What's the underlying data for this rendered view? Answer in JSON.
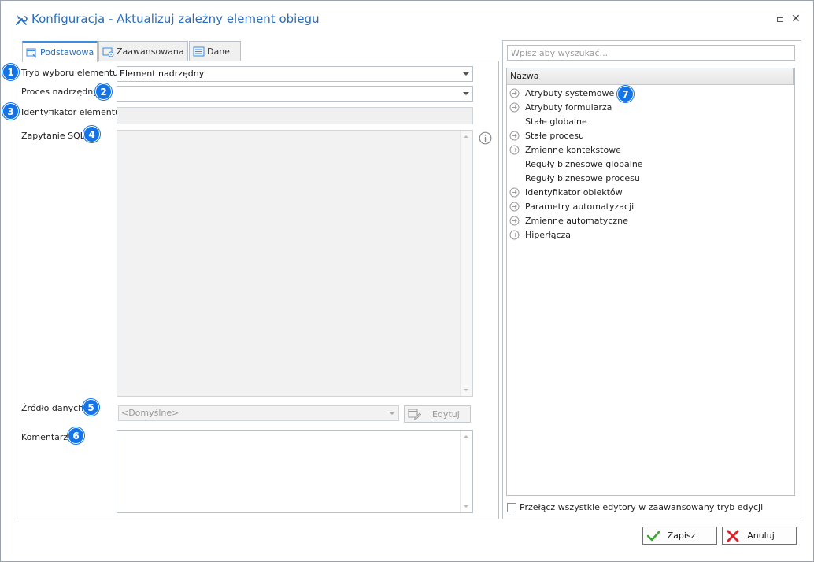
{
  "window": {
    "title": "Konfiguracja - Aktualizuj zależny element obiegu",
    "maximize_icon": "maximize-icon",
    "close_icon": "close-icon",
    "close_glyph": "✕"
  },
  "tabs": [
    {
      "label": "Podstawowa",
      "icon": "basic-settings-icon",
      "active": true
    },
    {
      "label": "Zaawansowana",
      "icon": "advanced-settings-icon",
      "active": false
    },
    {
      "label": "Dane",
      "icon": "data-list-icon",
      "active": false
    }
  ],
  "form": {
    "selection_mode": {
      "label": "Tryb wyboru elementu:",
      "value": "Element nadrzędny",
      "badge": "1"
    },
    "parent_process": {
      "label": "Proces nadrzędny:",
      "value": "",
      "badge": "2"
    },
    "element_id": {
      "label": "Identyfikator elementu:",
      "value": "",
      "badge": "3"
    },
    "sql_query": {
      "label": "Zapytanie SQL:",
      "value": "",
      "badge": "4"
    },
    "data_source": {
      "label": "Źródło danych:",
      "value": "<Domyślne>",
      "badge": "5",
      "edit_label": "Edytuj"
    },
    "comment": {
      "label": "Komentarz:",
      "value": "",
      "badge": "6"
    }
  },
  "right_panel": {
    "search_placeholder": "Wpisz aby wyszukać...",
    "column_header": "Nazwa",
    "badge": "7",
    "items": [
      {
        "label": "Atrybuty systemowe",
        "expandable": true
      },
      {
        "label": "Atrybuty formularza",
        "expandable": true
      },
      {
        "label": "Stałe globalne",
        "expandable": false
      },
      {
        "label": "Stałe procesu",
        "expandable": true
      },
      {
        "label": "Zmienne kontekstowe",
        "expandable": true
      },
      {
        "label": "Reguły biznesowe globalne",
        "expandable": false
      },
      {
        "label": "Reguły biznesowe procesu",
        "expandable": false
      },
      {
        "label": "Identyfikator obiektów",
        "expandable": true
      },
      {
        "label": "Parametry automatyzacji",
        "expandable": true
      },
      {
        "label": "Zmienne automatyczne",
        "expandable": true
      },
      {
        "label": "Hiperłącza",
        "expandable": true
      }
    ],
    "advanced_toggle_label": "Przełącz wszystkie edytory w zaawansowany tryb edycji"
  },
  "footer": {
    "save_label": "Zapisz",
    "cancel_label": "Anuluj"
  },
  "colors": {
    "accent": "#1473e6",
    "title": "#2a6ebb",
    "save_check": "#3aa830",
    "cancel_x": "#d9232e"
  }
}
